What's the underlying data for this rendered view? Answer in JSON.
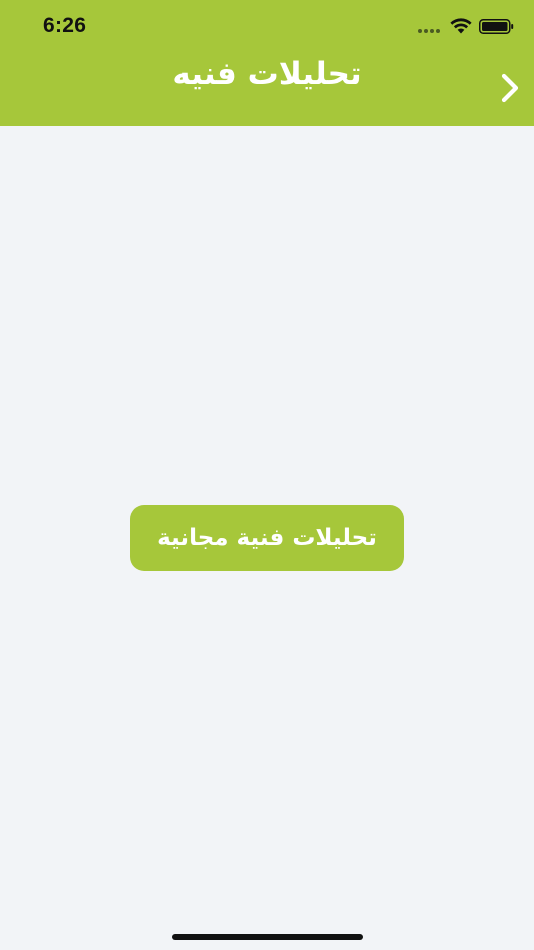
{
  "status_bar": {
    "time": "6:26",
    "icons": [
      "signal-dots-icon",
      "wifi-icon",
      "battery-icon"
    ]
  },
  "header": {
    "title": "تحليلات فنيه",
    "back_icon": "chevron-right-icon"
  },
  "main": {
    "button_label": "تحليلات فنية مجانية"
  },
  "colors": {
    "accent": "#a6c73a",
    "background": "#f2f4f7",
    "text_on_accent": "#ffffff"
  }
}
